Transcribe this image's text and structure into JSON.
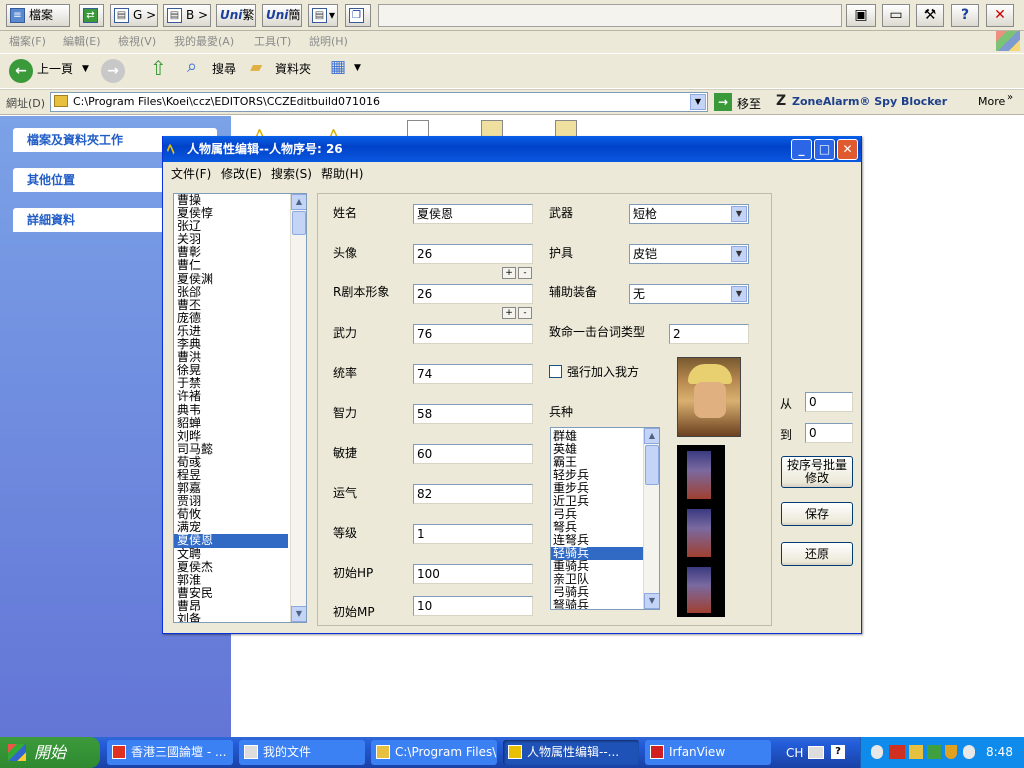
{
  "toolbar": {
    "items": [
      "檔案",
      "G > B",
      "B > G",
      "繁",
      "簡"
    ],
    "icon_labels": [
      "Uni",
      "Uni"
    ]
  },
  "explorer": {
    "menu": [
      "檔案(F)",
      "編輯(E)",
      "檢視(V)",
      "我的最愛(A)",
      "工具(T)",
      "說明(H)"
    ],
    "back_label": "上一頁",
    "search_label": "搜尋",
    "folders_label": "資料夾",
    "address_label": "網址(D)",
    "address_value": "C:\\Program Files\\Koei\\ccz\\EDITORS\\CCZEditbuild071016",
    "go_label": "移至",
    "zonealarm_label": "ZoneAlarm® Spy Blocker",
    "more_label": "More",
    "tasks": [
      "檔案及資料夾工作",
      "其他位置",
      "詳細資料"
    ]
  },
  "dialog": {
    "title": "人物属性编辑--人物序号: 26",
    "menu": [
      "文件(F)",
      "修改(E)",
      "搜索(S)",
      "帮助(H)"
    ],
    "names": [
      "曹操",
      "夏侯惇",
      "张辽",
      "关羽",
      "曹彰",
      "曹仁",
      "夏侯渊",
      "张郃",
      "曹丕",
      "庞德",
      "乐进",
      "李典",
      "曹洪",
      "徐晃",
      "于禁",
      "许褚",
      "典韦",
      "貂蝉",
      "刘晔",
      "司马懿",
      "荀彧",
      "程昱",
      "郭嘉",
      "贾诩",
      "荀攸",
      "满宠",
      "夏侯恩",
      "文聘",
      "夏侯杰",
      "郭淮",
      "曹安民",
      "曹昂",
      "刘备"
    ],
    "selected_name": "夏侯恩",
    "fields": {
      "name_label": "姓名",
      "name": "夏侯恩",
      "portrait_label": "头像",
      "portrait": "26",
      "rscript_label": "R剧本形象",
      "rscript": "26",
      "power_label": "武力",
      "power": "76",
      "command_label": "统率",
      "command": "74",
      "intel_label": "智力",
      "intel": "58",
      "agility_label": "敏捷",
      "agility": "60",
      "luck_label": "运气",
      "luck": "82",
      "level_label": "等级",
      "level": "1",
      "hp_label": "初始HP",
      "hp": "100",
      "mp_label": "初始MP",
      "mp": "10"
    },
    "weapon_label": "武器",
    "weapon": "短枪",
    "armor_label": "护具",
    "armor": "皮铠",
    "aux_label": "辅助装备",
    "aux": "无",
    "crit_label": "致命一击台词类型",
    "crit": "2",
    "force_join_label": "强行加入我方",
    "force_join_checked": false,
    "unit_label": "兵种",
    "units": [
      "群雄",
      "英雄",
      "霸王",
      "轻步兵",
      "重步兵",
      "近卫兵",
      "弓兵",
      "弩兵",
      "连弩兵",
      "轻骑兵",
      "重骑兵",
      "亲卫队",
      "弓骑兵",
      "弩骑兵"
    ],
    "selected_unit": "轻骑兵",
    "plus_label": "+",
    "minus_label": "-",
    "from_label": "从",
    "from": "0",
    "to_label": "到",
    "to": "0",
    "batch_label": "按序号批量修改",
    "save_label": "保存",
    "restore_label": "还原"
  },
  "taskbar": {
    "start_label": "開始",
    "tasks": [
      "香港三國論壇 - ...",
      "我的文件",
      "C:\\Program Files\\...",
      "人物属性编辑--...",
      "IrfanView"
    ],
    "active_index": 3,
    "lang": "CH",
    "clock": "8:48"
  },
  "colors": {
    "selection": "#316ac5",
    "titlebar": "#0a5fe8",
    "taskpane": "#6f8fdf"
  }
}
